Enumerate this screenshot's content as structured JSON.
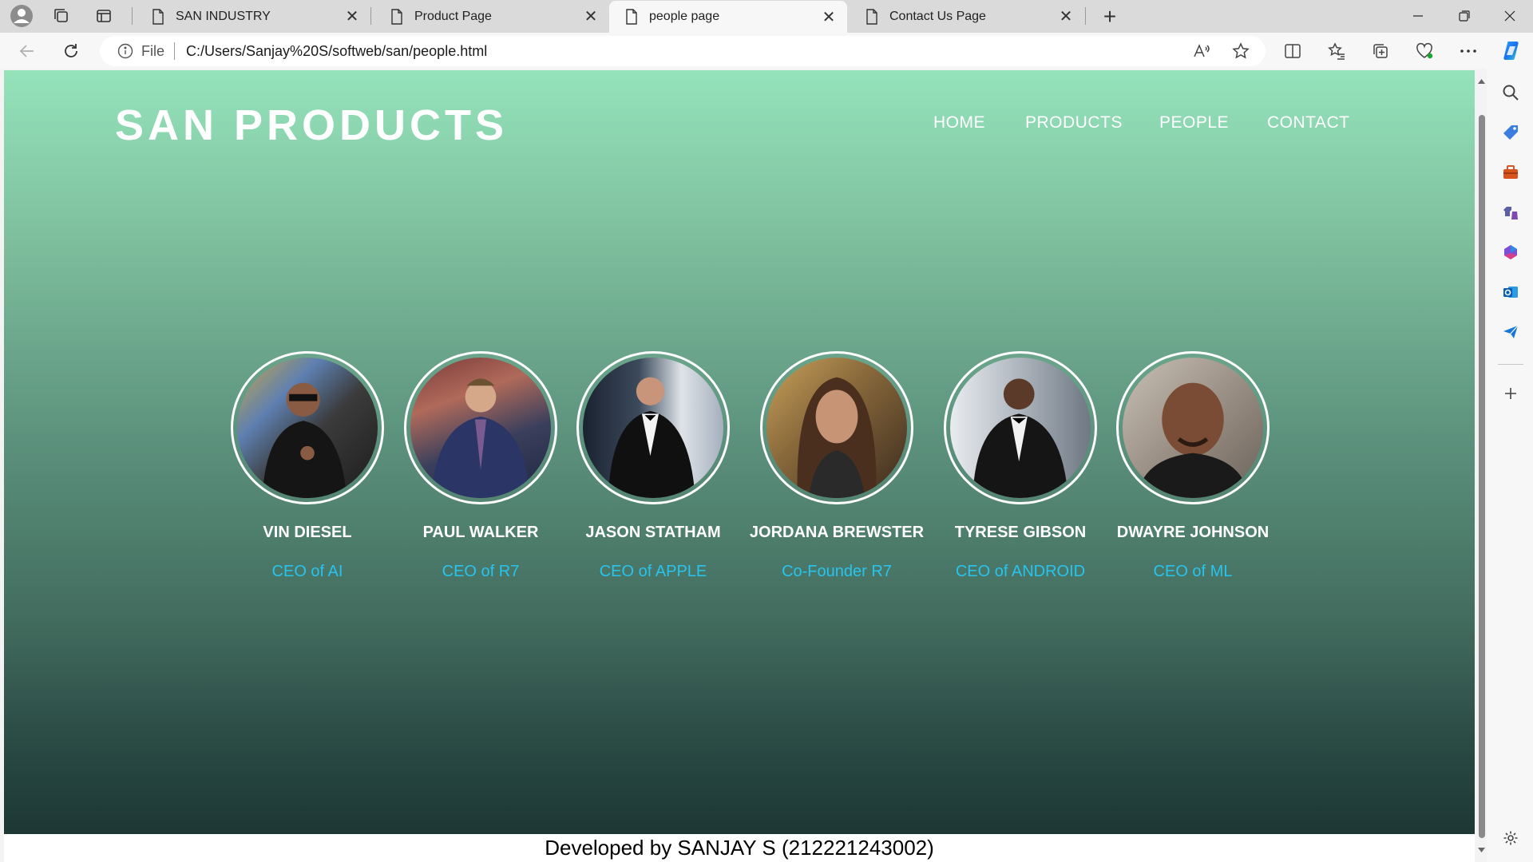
{
  "browser": {
    "tabs": [
      {
        "title": "SAN INDUSTRY",
        "active": false
      },
      {
        "title": "Product Page",
        "active": false
      },
      {
        "title": "people page",
        "active": true
      },
      {
        "title": "Contact Us Page",
        "active": false
      }
    ],
    "address": {
      "scheme": "File",
      "url": "C:/Users/Sanjay%20S/softweb/san/people.html"
    }
  },
  "page": {
    "logo": "SAN PRODUCTS",
    "nav": [
      "HOME",
      "PRODUCTS",
      "PEOPLE",
      "CONTACT"
    ],
    "people": [
      {
        "name": "VIN DIESEL",
        "role": "CEO of AI"
      },
      {
        "name": "PAUL WALKER",
        "role": "CEO of R7"
      },
      {
        "name": "JASON STATHAM",
        "role": "CEO of APPLE"
      },
      {
        "name": "JORDANA BREWSTER",
        "role": "Co-Founder R7"
      },
      {
        "name": "TYRESE GIBSON",
        "role": "CEO of ANDROID"
      },
      {
        "name": "DWAYRE JOHNSON",
        "role": "CEO of ML"
      }
    ],
    "footer": "Developed by SANJAY S (212221243002)"
  },
  "colors": {
    "gradient_top": "#94e3bb",
    "gradient_bottom": "#1d3734",
    "role_text": "#27c4ef",
    "heading_text": "#ffffff"
  }
}
